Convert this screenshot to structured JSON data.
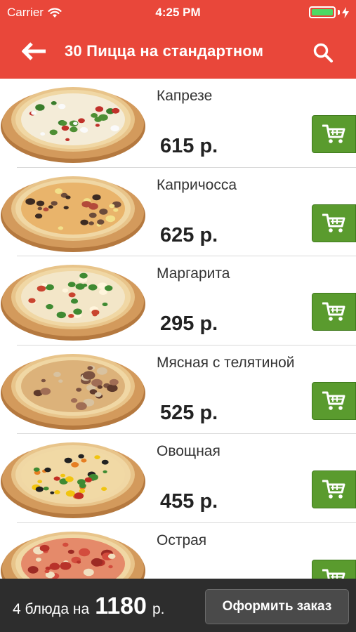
{
  "status_bar": {
    "carrier": "Carrier",
    "time": "4:25 PM",
    "icons": [
      "wifi-icon",
      "battery-icon",
      "charging-icon"
    ]
  },
  "navbar": {
    "title": "30 Пицца на стандартном",
    "back_icon": "back-arrow-icon",
    "search_icon": "search-icon"
  },
  "items": [
    {
      "name": "Капрезе",
      "price": "615 р.",
      "style": "caprese"
    },
    {
      "name": "Капричосса",
      "price": "625 р.",
      "style": "capricciosa"
    },
    {
      "name": "Маргарита",
      "price": "295 р.",
      "style": "margherita"
    },
    {
      "name": "Мясная с телятиной",
      "price": "525 р.",
      "style": "meat"
    },
    {
      "name": "Овощная",
      "price": "455 р.",
      "style": "veggie"
    },
    {
      "name": "Острая",
      "price": "",
      "style": "spicy"
    }
  ],
  "cart_icon": "shopping-cart-icon",
  "footer": {
    "summary_text": "4 блюда на",
    "total": "1180",
    "currency": "р.",
    "checkout_label": "Оформить заказ"
  },
  "colors": {
    "header": "#e9473a",
    "cart_button": "#5a9b2e",
    "footer": "#2d2d2d",
    "battery": "#4cd964"
  }
}
